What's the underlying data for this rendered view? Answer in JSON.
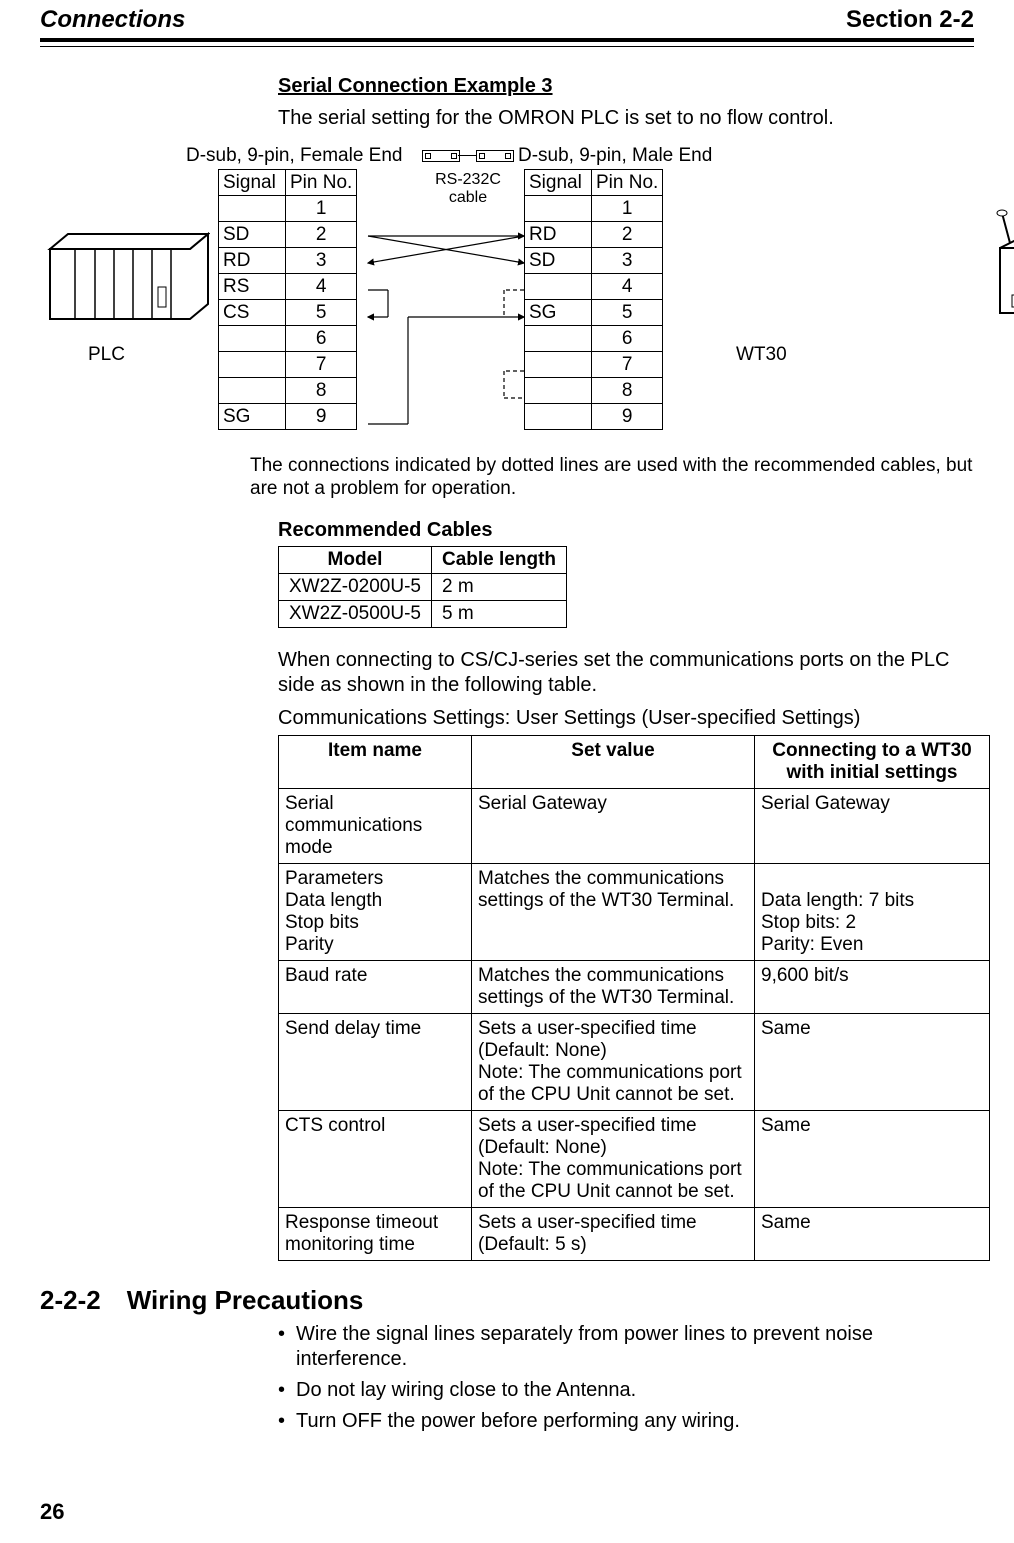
{
  "header": {
    "left": "Connections",
    "right": "Section 2-2"
  },
  "serial": {
    "heading": "Serial Connection Example 3",
    "intro": "The serial setting for the OMRON PLC is set to no flow control.",
    "female_label": "D-sub, 9-pin, Female End",
    "male_label": "D-sub, 9-pin, Male End",
    "cable_label1": "RS-232C",
    "cable_label2": "cable",
    "plc_label": "PLC",
    "wt30_label": "WT30",
    "cols": {
      "signal": "Signal",
      "pin": "Pin No."
    },
    "left_rows": [
      {
        "signal": "",
        "pin": "1"
      },
      {
        "signal": "SD",
        "pin": "2"
      },
      {
        "signal": "RD",
        "pin": "3"
      },
      {
        "signal": "RS",
        "pin": "4"
      },
      {
        "signal": "CS",
        "pin": "5"
      },
      {
        "signal": "",
        "pin": "6"
      },
      {
        "signal": "",
        "pin": "7"
      },
      {
        "signal": "",
        "pin": "8"
      },
      {
        "signal": "SG",
        "pin": "9"
      }
    ],
    "right_rows": [
      {
        "signal": "",
        "pin": "1"
      },
      {
        "signal": "RD",
        "pin": "2"
      },
      {
        "signal": "SD",
        "pin": "3"
      },
      {
        "signal": "",
        "pin": "4"
      },
      {
        "signal": "SG",
        "pin": "5"
      },
      {
        "signal": "",
        "pin": "6"
      },
      {
        "signal": "",
        "pin": "7"
      },
      {
        "signal": "",
        "pin": "8"
      },
      {
        "signal": "",
        "pin": "9"
      }
    ],
    "note": "The connections indicated by dotted lines are used with the recommended cables, but are not a problem for operation."
  },
  "recommended": {
    "heading": "Recommended Cables",
    "cols": {
      "model": "Model",
      "length": "Cable length"
    },
    "rows": [
      {
        "model": "XW2Z-0200U-5",
        "length": "2 m"
      },
      {
        "model": "XW2Z-0500U-5",
        "length": "5 m"
      }
    ]
  },
  "settings": {
    "intro1": "When connecting to CS/CJ-series set the communications ports on the PLC side as shown in the following table.",
    "intro2": "Communications Settings: User Settings (User-specified Settings)",
    "cols": {
      "item": "Item name",
      "set": "Set value",
      "conn": "Connecting to a WT30 with initial settings"
    },
    "rows": [
      {
        "item": "Serial communications mode",
        "set": "Serial Gateway",
        "conn": "Serial Gateway"
      },
      {
        "item": "Parameters\nData length\nStop bits\nParity",
        "set": "Matches the communications settings of the WT30 Terminal.",
        "conn": "\nData length: 7 bits\nStop bits: 2\nParity: Even"
      },
      {
        "item": "Baud rate",
        "set": "Matches the communications settings of the WT30 Terminal.",
        "conn": "9,600 bit/s"
      },
      {
        "item": "Send delay time",
        "set": "Sets a user-specified time\n(Default: None)\nNote: The communications port of the CPU Unit cannot be set.",
        "conn": "Same"
      },
      {
        "item": "CTS control",
        "set": "Sets a user-specified time\n(Default: None)\nNote: The communications port of the CPU Unit cannot be set.",
        "conn": "Same"
      },
      {
        "item": "Response timeout monitoring time",
        "set": "Sets a user-specified time\n(Default: 5 s)",
        "conn": "Same"
      }
    ]
  },
  "precautions": {
    "heading": "2-2-2 Wiring Precautions",
    "items": [
      "Wire the signal lines separately from power lines to prevent noise interference.",
      "Do not lay wiring close to the Antenna.",
      "Turn OFF the power before performing any wiring."
    ]
  },
  "page_number": "26"
}
